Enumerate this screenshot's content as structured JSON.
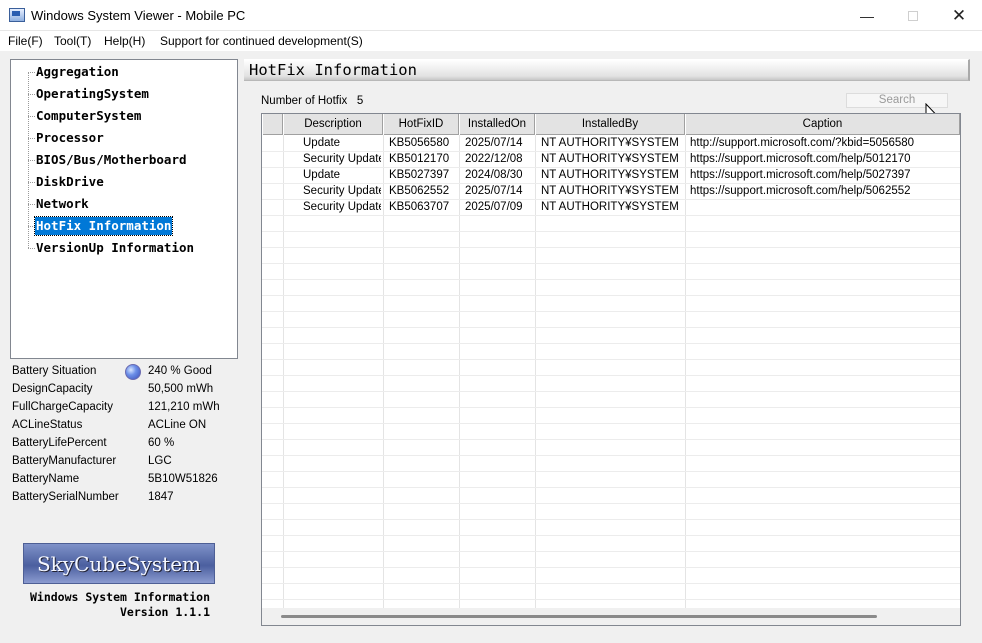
{
  "window": {
    "title": "Windows System Viewer - Mobile PC",
    "min_glyph": "—",
    "close_glyph": "✕"
  },
  "menu": [
    "File(F)",
    "Tool(T)",
    "Help(H)",
    "Support for continued development(S)"
  ],
  "tree": {
    "items": [
      {
        "label": "Aggregation"
      },
      {
        "label": "OperatingSystem"
      },
      {
        "label": "ComputerSystem"
      },
      {
        "label": "Processor"
      },
      {
        "label": "BIOS/Bus/Motherboard"
      },
      {
        "label": "DiskDrive"
      },
      {
        "label": "Network"
      },
      {
        "label": "HotFix Information",
        "selected": true
      },
      {
        "label": "VersionUp Information"
      }
    ]
  },
  "battery": [
    {
      "label": "Battery Situation",
      "value": "240 % Good",
      "orb": true
    },
    {
      "label": "DesignCapacity",
      "value": "50,500 mWh"
    },
    {
      "label": "FullChargeCapacity",
      "value": "121,210 mWh"
    },
    {
      "label": "ACLineStatus",
      "value": "ACLine ON"
    },
    {
      "label": "BatteryLifePercent",
      "value": "60 %"
    },
    {
      "label": "BatteryManufacturer",
      "value": "LGC"
    },
    {
      "label": "BatteryName",
      "value": "5B10W51826"
    },
    {
      "label": "BatterySerialNumber",
      "value": "1847"
    }
  ],
  "brand": {
    "logo_text": "SkyCubeSystem",
    "product": "Windows System Information",
    "version": "Version 1.1.1"
  },
  "section": {
    "title": "HotFix Information",
    "count_label": "Number of Hotfix",
    "count_value": "5",
    "search_label": "Search"
  },
  "table": {
    "columns": [
      "Description",
      "HotFixID",
      "InstalledOn",
      "InstalledBy",
      "Caption"
    ],
    "rows": [
      [
        "Update",
        "KB5056580",
        "2025/07/14",
        "NT AUTHORITY¥SYSTEM",
        "http://support.microsoft.com/?kbid=5056580"
      ],
      [
        "Security Update",
        "KB5012170",
        "2022/12/08",
        "NT AUTHORITY¥SYSTEM",
        "https://support.microsoft.com/help/5012170"
      ],
      [
        "Update",
        "KB5027397",
        "2024/08/30",
        "NT AUTHORITY¥SYSTEM",
        "https://support.microsoft.com/help/5027397"
      ],
      [
        "Security Update",
        "KB5062552",
        "2025/07/14",
        "NT AUTHORITY¥SYSTEM",
        "https://support.microsoft.com/help/5062552"
      ],
      [
        "Security Update",
        "KB5063707",
        "2025/07/09",
        "NT AUTHORITY¥SYSTEM",
        ""
      ]
    ]
  },
  "colors": {
    "selection": "#0078d7",
    "header_bg": "#e3e3e3"
  }
}
